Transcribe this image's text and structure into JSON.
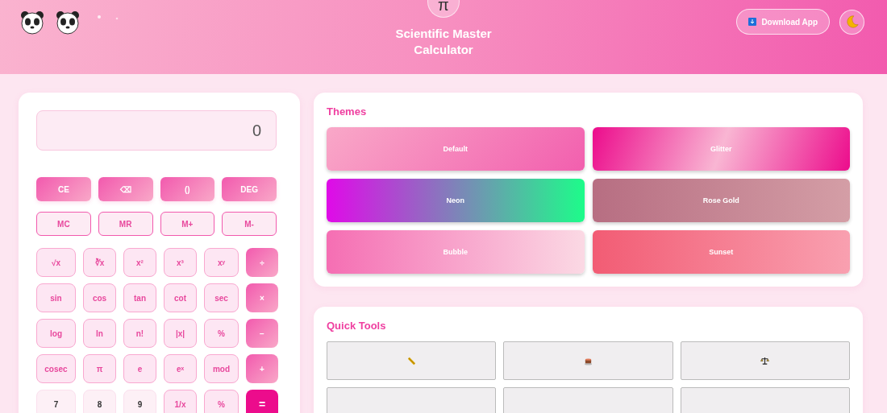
{
  "header": {
    "title_lines": [
      "Scientific Master",
      "Calculator"
    ],
    "logo_symbol": "π",
    "download_button": "Download App"
  },
  "display": {
    "value": "0"
  },
  "key_rows": [
    {
      "kind": "action",
      "keys": [
        "CE",
        "⌫",
        "()",
        "DEG"
      ]
    },
    {
      "kind": "memory",
      "keys": [
        "MC",
        "MR",
        "M+",
        "M-"
      ]
    }
  ],
  "keypad": [
    {
      "label": "√x",
      "kind": "fn"
    },
    {
      "label": "∛x",
      "kind": "fn"
    },
    {
      "label": "x²",
      "kind": "fn"
    },
    {
      "label": "x³",
      "kind": "fn"
    },
    {
      "label": "xʸ",
      "kind": "fn"
    },
    {
      "label": "÷",
      "kind": "op"
    },
    {
      "label": "sin",
      "kind": "fn"
    },
    {
      "label": "cos",
      "kind": "fn"
    },
    {
      "label": "tan",
      "kind": "fn"
    },
    {
      "label": "cot",
      "kind": "fn"
    },
    {
      "label": "sec",
      "kind": "fn"
    },
    {
      "label": "×",
      "kind": "op"
    },
    {
      "label": "log",
      "kind": "fn"
    },
    {
      "label": "ln",
      "kind": "fn"
    },
    {
      "label": "n!",
      "kind": "fn"
    },
    {
      "label": "|x|",
      "kind": "fn"
    },
    {
      "label": "%",
      "kind": "fn"
    },
    {
      "label": "−",
      "kind": "op"
    },
    {
      "label": "cosec",
      "kind": "fn"
    },
    {
      "label": "π",
      "kind": "fn"
    },
    {
      "label": "e",
      "kind": "fn"
    },
    {
      "label": "eˣ",
      "kind": "fn"
    },
    {
      "label": "mod",
      "kind": "fn"
    },
    {
      "label": "+",
      "kind": "op"
    },
    {
      "label": "7",
      "kind": "num"
    },
    {
      "label": "8",
      "kind": "num"
    },
    {
      "label": "9",
      "kind": "num"
    },
    {
      "label": "1/x",
      "kind": "fn"
    },
    {
      "label": "%",
      "kind": "fn"
    },
    {
      "label": "=",
      "kind": "equals"
    }
  ],
  "themes": {
    "title": "Themes",
    "items": [
      {
        "name": "Default",
        "kind": "default"
      },
      {
        "name": "Glitter",
        "kind": "glitter"
      },
      {
        "name": "Neon",
        "kind": "neon"
      },
      {
        "name": "Rose Gold",
        "kind": "rose_gold"
      },
      {
        "name": "Bubble",
        "kind": "bubble"
      },
      {
        "name": "Sunset",
        "kind": "sunset"
      }
    ]
  },
  "quick_tools": {
    "title": "Quick Tools",
    "items": [
      {
        "kind": "ruler"
      },
      {
        "kind": "cake"
      },
      {
        "kind": "scale"
      },
      {
        "kind": "cut_off"
      },
      {
        "kind": "cut_off"
      },
      {
        "kind": "cut_off"
      }
    ]
  }
}
